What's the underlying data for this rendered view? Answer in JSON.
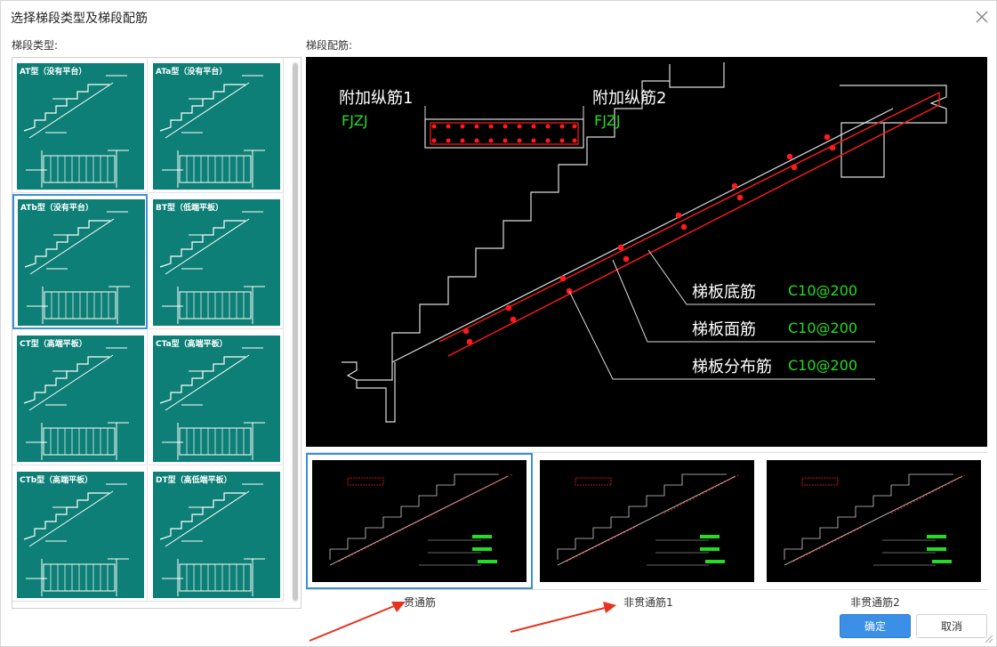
{
  "dialog": {
    "title": "选择梯段类型及梯段配筋",
    "types_label": "梯段类型:",
    "rebar_label": "梯段配筋:",
    "ok_label": "确定",
    "cancel_label": "取消"
  },
  "stair_types": [
    {
      "name": "AT型（没有平台）",
      "selected": false
    },
    {
      "name": "ATa型（没有平台）",
      "selected": false
    },
    {
      "name": "ATb型（没有平台）",
      "selected": true
    },
    {
      "name": "BT型（低端平板）",
      "selected": false
    },
    {
      "name": "CT型（高端平板）",
      "selected": false
    },
    {
      "name": "CTa型（高端平板）",
      "selected": false
    },
    {
      "name": "CTb型（高端平板）",
      "selected": false
    },
    {
      "name": "DT型（高低端平板）",
      "selected": false
    }
  ],
  "preview": {
    "extra_bar_1": "附加纵筋1",
    "extra_bar_1_code": "FJZJ",
    "extra_bar_2": "附加纵筋2",
    "extra_bar_2_code": "FJZJ",
    "bottom_bar": "梯板底筋",
    "bottom_bar_spec": "C10@200",
    "top_bar": "梯板面筋",
    "top_bar_spec": "C10@200",
    "dist_bar": "梯板分布筋",
    "dist_bar_spec": "C10@200"
  },
  "rebar_options": [
    {
      "caption": "贯通筋",
      "selected": true
    },
    {
      "caption": "非贯通筋1",
      "selected": false
    },
    {
      "caption": "非贯通筋2",
      "selected": false
    }
  ],
  "colors": {
    "accent": "#3b8fe6",
    "thumb_bg": "#0d7f76",
    "rebar_red": "#ff1a1a",
    "label_green": "#22dd22",
    "annotation_arrow": "#e8321e"
  }
}
